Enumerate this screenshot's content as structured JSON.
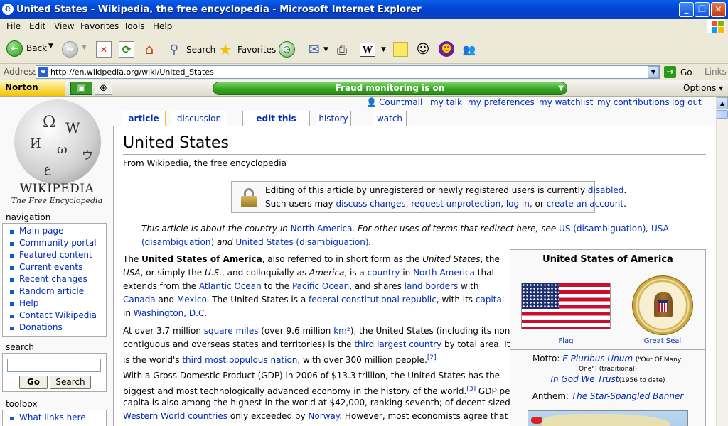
{
  "window": {
    "title": "United States - Wikipedia, the free encyclopedia - Microsoft Internet Explorer"
  },
  "menu": [
    "File",
    "Edit",
    "View",
    "Favorites",
    "Tools",
    "Help"
  ],
  "toolbar": {
    "back": "Back",
    "search": "Search",
    "favorites": "Favorites"
  },
  "address": {
    "label": "Address",
    "url": "http://en.wikipedia.org/wiki/United_States",
    "go": "Go",
    "links": "Links"
  },
  "norton": {
    "brand": "Norton",
    "fraud": "Fraud monitoring is on",
    "options": "Options"
  },
  "wiki": {
    "logo_name": "WIKIPEDIA",
    "logo_tag": "The Free Encyclopedia",
    "navigation_label": "navigation",
    "nav": [
      "Main page",
      "Community portal",
      "Featured content",
      "Current events",
      "Recent changes",
      "Random article",
      "Help",
      "Contact Wikipedia",
      "Donations"
    ],
    "search_label": "search",
    "search_go": "Go",
    "search_btn": "Search",
    "toolbox_label": "toolbox",
    "toolbox": [
      "What links here"
    ],
    "personal": {
      "user": "Countmall",
      "talk": "my talk",
      "prefs": "my preferences",
      "watchlist": "my watchlist",
      "contribs": "my contributions",
      "logout": "log out"
    },
    "tabs": {
      "article": "article",
      "discussion": "discussion",
      "edit": "edit this page",
      "history": "history",
      "watch": "watch"
    }
  },
  "article": {
    "title": "United States",
    "subtitle": "From Wikipedia, the free encyclopedia",
    "protect_1a": "Editing of this article by unregistered or newly registered users is currently ",
    "protect_1b": "disabled",
    "protect_2a": "Such users may ",
    "protect_2b": "discuss changes",
    "protect_2c": ", ",
    "protect_2d": "request unprotection",
    "protect_2e": ", ",
    "protect_2f": "log in",
    "protect_2g": ", or ",
    "protect_2h": "create an account",
    "dab_1a": "This article is about the country in ",
    "dab_1b": "North America",
    "dab_1c": ". For other uses of terms that redirect here, see ",
    "dab_1d": "US (disambiguation)",
    "dab_1e": ", ",
    "dab_1f": "USA",
    "dab_2a": "(disambiguation)",
    "dab_2b": " and ",
    "dab_2c": "United States (disambiguation)"
  },
  "infobox": {
    "title": "United States of America",
    "flag": "Flag",
    "seal": "Great Seal",
    "motto_label": "Motto: ",
    "motto": "E Pluribus Unum",
    "motto_tr": "(\"Out Of Many,",
    "motto_tr2": "One\") (traditional)",
    "motto2": "In God We Trust",
    "motto2_note": "(1956 to date)",
    "anthem_label": "Anthem: ",
    "anthem": "The Star-Spangled Banner"
  }
}
